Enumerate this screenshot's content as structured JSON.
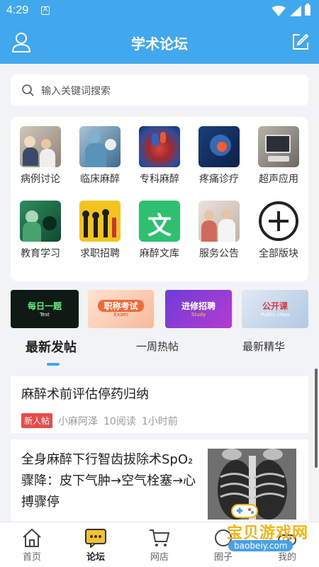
{
  "status_bar": {
    "time": "4:29",
    "sim_label": "A"
  },
  "app_bar": {
    "title": "学术论坛"
  },
  "search": {
    "placeholder": "输入关键词搜索"
  },
  "categories": [
    {
      "label": "病例讨论",
      "icon": "case-discussion-icon"
    },
    {
      "label": "临床麻醉",
      "icon": "clinical-anesthesia-icon"
    },
    {
      "label": "专科麻醉",
      "icon": "specialty-anesthesia-icon"
    },
    {
      "label": "疼痛诊疗",
      "icon": "pain-treatment-icon"
    },
    {
      "label": "超声应用",
      "icon": "ultrasound-icon"
    },
    {
      "label": "教育学习",
      "icon": "education-icon"
    },
    {
      "label": "求职招聘",
      "icon": "jobs-icon"
    },
    {
      "label": "麻醉文库",
      "icon": "library-icon",
      "glyph": "文"
    },
    {
      "label": "服务公告",
      "icon": "announcement-icon"
    },
    {
      "label": "全部版块",
      "icon": "plus-circle-icon"
    }
  ],
  "banners": [
    {
      "text": "每日一题",
      "sub": "Test"
    },
    {
      "text": "职称考试",
      "sub": "Exam"
    },
    {
      "text": "进修招聘",
      "sub": "Study"
    },
    {
      "text": "公开课",
      "sub": "Public class"
    }
  ],
  "tabs": [
    "最新发帖",
    "一周热帖",
    "最新精华"
  ],
  "posts": [
    {
      "title": "麻醉术前评估停药归纳",
      "tag": "新人帖",
      "author": "小麻阿泽",
      "reads": "10阅读",
      "time": "1小时前"
    },
    {
      "title": "全身麻醉下行智齿拔除术SpO₂骤降：皮下气肿→空气栓塞→心搏骤停"
    }
  ],
  "nav": [
    "首页",
    "论坛",
    "网店",
    "圈子",
    "我的"
  ],
  "watermark": {
    "text": "宝贝游戏网",
    "url": "baobeiy.com"
  },
  "colors": {
    "primary": "#41a8ee",
    "tag_red": "#e94b4b"
  }
}
